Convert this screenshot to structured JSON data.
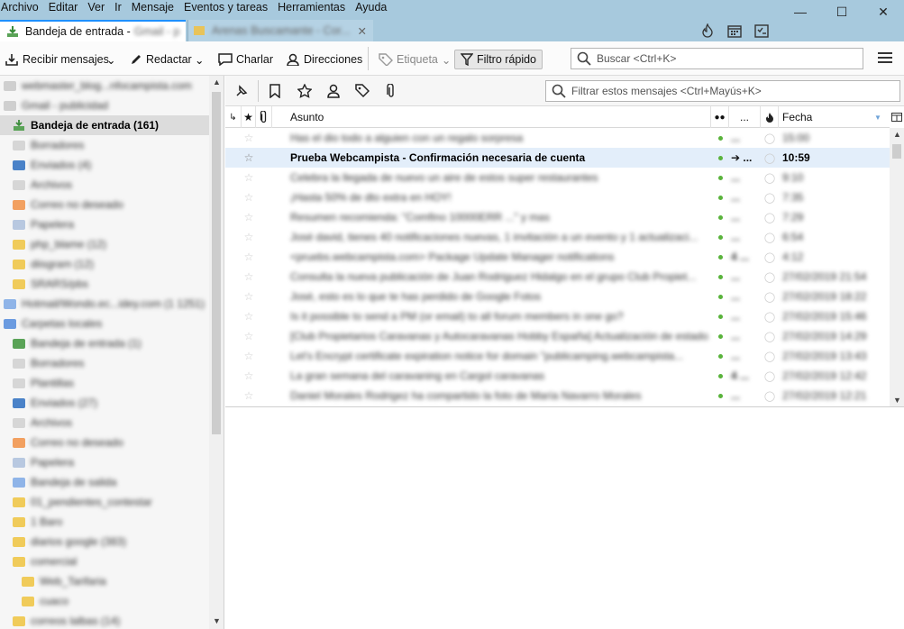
{
  "menu": [
    "Archivo",
    "Editar",
    "Ver",
    "Ir",
    "Mensaje",
    "Eventos y tareas",
    "Herramientas",
    "Ayuda"
  ],
  "tabs": {
    "active_label": "Bandeja de entrada -",
    "active_blur": "Gmail - p",
    "inactive_blur": "Arenas Buscamante - Cor..."
  },
  "toolbar": {
    "get_messages": "Recibir mensajes",
    "write": "Redactar",
    "chat": "Charlar",
    "address_book": "Direcciones",
    "tag": "Etiqueta",
    "quick_filter": "Filtro rápido",
    "search_placeholder": "Buscar <Ctrl+K>"
  },
  "filterbar": {
    "placeholder": "Filtrar estos mensajes <Ctrl+Mayús+K>"
  },
  "columns": {
    "subject": "Asunto",
    "correspondents": "...",
    "date": "Fecha"
  },
  "sidebar": {
    "folders": [
      {
        "label": "webmaster_blog...nfocampista.com",
        "color": "#cfcfcf",
        "indent": 4
      },
      {
        "label": "Gmail - publicidad",
        "color": "#cfcfcf",
        "indent": 4
      },
      {
        "label": "Bandeja de entrada (161)",
        "color": "#5aa357",
        "indent": 14,
        "selected": true
      },
      {
        "label": "Borradores",
        "color": "#d6d6d6",
        "indent": 14
      },
      {
        "label": "Enviados (4)",
        "color": "#4a82c8",
        "indent": 14
      },
      {
        "label": "Archivos",
        "color": "#d6d6d6",
        "indent": 14
      },
      {
        "label": "Correo no deseado",
        "color": "#f2a060",
        "indent": 14
      },
      {
        "label": "Papelera",
        "color": "#b8c8e0",
        "indent": 14
      },
      {
        "label": "php_blame (12)",
        "color": "#f0cb5a",
        "indent": 14
      },
      {
        "label": "diisgram (12)",
        "color": "#f0cb5a",
        "indent": 14
      },
      {
        "label": "SRARS/pbs",
        "color": "#f0cb5a",
        "indent": 14
      },
      {
        "label": "Hotmail/Wondo.ec...idey.com (1 1251)",
        "color": "#8fb4e8",
        "indent": 4
      },
      {
        "label": "Carpetas locales",
        "color": "#6b9be0",
        "indent": 4
      },
      {
        "label": "Bandeja de entrada (1)",
        "color": "#5aa357",
        "indent": 14
      },
      {
        "label": "Borradores",
        "color": "#d6d6d6",
        "indent": 14
      },
      {
        "label": "Plantillas",
        "color": "#d6d6d6",
        "indent": 14
      },
      {
        "label": "Enviados (27)",
        "color": "#4a82c8",
        "indent": 14
      },
      {
        "label": "Archivos",
        "color": "#d6d6d6",
        "indent": 14
      },
      {
        "label": "Correo no deseado",
        "color": "#f2a060",
        "indent": 14
      },
      {
        "label": "Papelera",
        "color": "#b8c8e0",
        "indent": 14
      },
      {
        "label": "Bandeja de salida",
        "color": "#8fb4e8",
        "indent": 14
      },
      {
        "label": "01_pendientes_contestar",
        "color": "#f0cb5a",
        "indent": 14
      },
      {
        "label": "1 Baro",
        "color": "#f0cb5a",
        "indent": 14
      },
      {
        "label": "diarios google (383)",
        "color": "#f0cb5a",
        "indent": 14
      },
      {
        "label": "comercial",
        "color": "#f0cb5a",
        "indent": 14
      },
      {
        "label": "Web_Tarifaria",
        "color": "#f0cb5a",
        "indent": 24
      },
      {
        "label": "cuaco",
        "color": "#f0cb5a",
        "indent": 24
      },
      {
        "label": "correos lalbas (14)",
        "color": "#f0cb5a",
        "indent": 14
      }
    ]
  },
  "messages": [
    {
      "subject": "Has el dio todo a alguien con un regalo sorpresa",
      "corr": "...",
      "date": "15:00"
    },
    {
      "subject": "Prueba Webcampista - Confirmación necesaria de cuenta",
      "corr": "➔ ...",
      "date": "10:59",
      "selected": true
    },
    {
      "subject": "Celebra la llegada de nuevo un aire de estos super restaurantes",
      "corr": "...",
      "date": "9:10"
    },
    {
      "subject": "¡Hasta 50% de dto extra en HOY!",
      "corr": "...",
      "date": "7:35"
    },
    {
      "subject": "Resumen recomienda: \"Comfino 10000ERR ...\" y mas",
      "corr": "...",
      "date": "7:29"
    },
    {
      "subject": "José david, tienes 40 notificaciones nuevas, 1 invitación a un evento y 1 actualizaci...",
      "corr": "...",
      "date": "6:54"
    },
    {
      "subject": "<pruebs.webcampista.com> Package Update Manager notifications",
      "corr": "4 ...",
      "date": "4:12"
    },
    {
      "subject": "Consulta la nueva publicación de Juan Rodriguez Hidalgo en el grupo Club Propiet...",
      "corr": "...",
      "date": "27/02/2019 21:54"
    },
    {
      "subject": "José, esto es lo que te has perdido de Google Fotos",
      "corr": "...",
      "date": "27/02/2019 18:22"
    },
    {
      "subject": "Is it possible to send a PM (or email) to all forum members in one go?",
      "corr": "...",
      "date": "27/02/2019 15:46"
    },
    {
      "subject": "[Club Propietarios Caravanas y Autocaravanas Hobby España] Actualización de estado...",
      "corr": "...",
      "date": "27/02/2019 14:29"
    },
    {
      "subject": "Let's Encrypt certificate expiration notice for domain \"publicamping.webcampista...",
      "corr": "...",
      "date": "27/02/2019 13:43"
    },
    {
      "subject": "La gran semana del caravaning en Cargol caravanas",
      "corr": "4 ...",
      "date": "27/02/2019 12:42"
    },
    {
      "subject": "Daniel Morales Rodrigez ha compartido la foto de María Navarro Morales",
      "corr": "...",
      "date": "27/02/2019 12:21"
    }
  ]
}
